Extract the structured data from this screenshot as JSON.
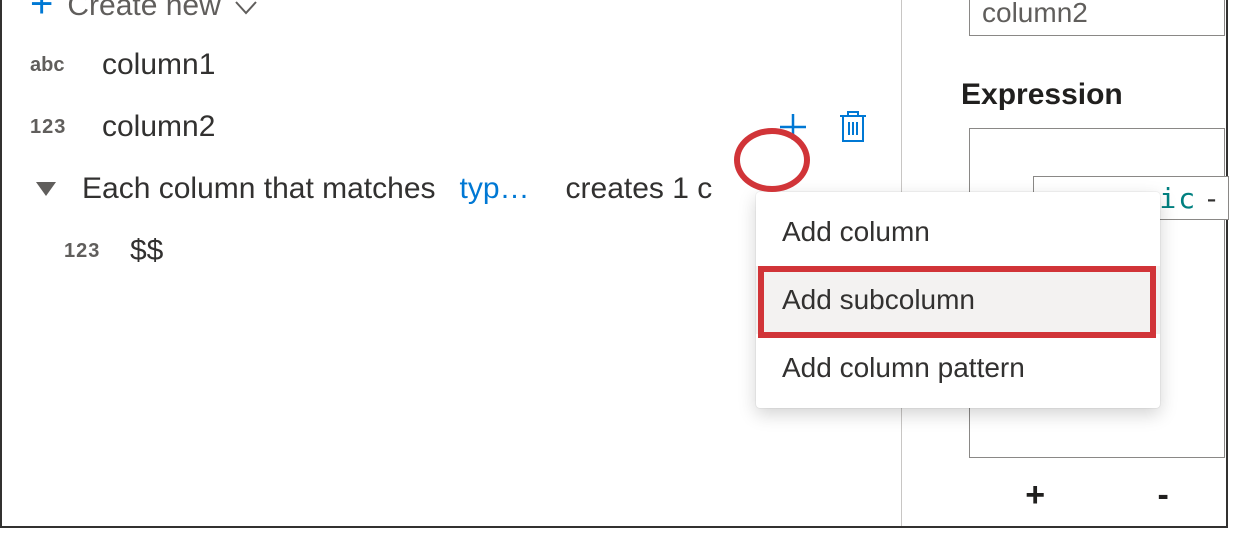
{
  "create": {
    "label": "Create new"
  },
  "columns": [
    {
      "type_badge": "abc",
      "name": "column1"
    },
    {
      "type_badge": "123",
      "name": "column2"
    }
  ],
  "match_row": {
    "prefix": "Each column that matches",
    "type_token": "typ…",
    "suffix": "creates 1 c"
  },
  "sub": {
    "type_badge": "123",
    "name": "$$"
  },
  "menu": {
    "items": [
      {
        "label": "Add column"
      },
      {
        "label": "Add subcolumn"
      },
      {
        "label": "Add column pattern"
      }
    ]
  },
  "right": {
    "name_value": "column2",
    "expression_label": "Expression",
    "pill_fragment": "ic",
    "plus": "+",
    "minus": "-"
  }
}
